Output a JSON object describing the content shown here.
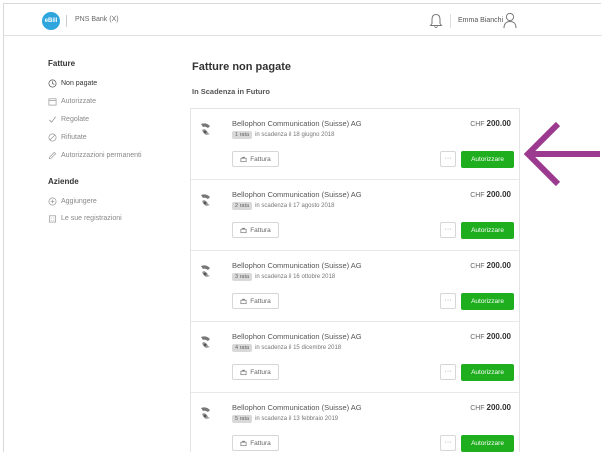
{
  "header": {
    "logo_text": "eBill",
    "bank_name": "PNS Bank (X)",
    "user_name": "Emma Bianchi"
  },
  "sidebar": {
    "section1_title": "Fatture",
    "items": [
      {
        "label": "Non pagate",
        "icon": "clock-icon",
        "active": true
      },
      {
        "label": "Autorizzate",
        "icon": "calendar-icon",
        "active": false
      },
      {
        "label": "Regolate",
        "icon": "check-icon",
        "active": false
      },
      {
        "label": "Rifiutate",
        "icon": "ban-icon",
        "active": false
      },
      {
        "label": "Autorizzazioni permanenti",
        "icon": "pen-icon",
        "active": false
      }
    ],
    "section2_title": "Aziende",
    "items2": [
      {
        "label": "Aggiungere",
        "icon": "plus-circle-icon"
      },
      {
        "label": "Le sue registrazioni",
        "icon": "building-icon"
      }
    ]
  },
  "main": {
    "title": "Fatture non pagate",
    "subtitle": "In Scadenza in Futuro",
    "invoices": [
      {
        "company": "Bellophon Communication (Suisse) AG",
        "rata": "1 rata",
        "due": "in scadenza il 18 giugno 2018",
        "currency": "CHF",
        "amount": "200.00",
        "fattura_label": "Fattura",
        "more_label": "···",
        "authorize_label": "Autorizzare"
      },
      {
        "company": "Bellophon Communication (Suisse) AG",
        "rata": "2 rata",
        "due": "in scadenza il 17 agosto 2018",
        "currency": "CHF",
        "amount": "200.00",
        "fattura_label": "Fattura",
        "more_label": "···",
        "authorize_label": "Autorizzare"
      },
      {
        "company": "Bellophon Communication (Suisse) AG",
        "rata": "3 rata",
        "due": "in scadenza il 16 ottobre 2018",
        "currency": "CHF",
        "amount": "200.00",
        "fattura_label": "Fattura",
        "more_label": "···",
        "authorize_label": "Autorizzare"
      },
      {
        "company": "Bellophon Communication (Suisse) AG",
        "rata": "4 rata",
        "due": "in scadenza il 15 dicembre 2018",
        "currency": "CHF",
        "amount": "200.00",
        "fattura_label": "Fattura",
        "more_label": "···",
        "authorize_label": "Autorizzare"
      },
      {
        "company": "Bellophon Communication (Suisse) AG",
        "rata": "5 rata",
        "due": "in scadenza il 13 febbraio 2019",
        "currency": "CHF",
        "amount": "200.00",
        "fattura_label": "Fattura",
        "more_label": "···",
        "authorize_label": "Autorizzare"
      }
    ]
  },
  "colors": {
    "accent_green": "#1eae1e",
    "logo_blue": "#2ea6dd",
    "arrow_purple": "#9b3a8e"
  }
}
